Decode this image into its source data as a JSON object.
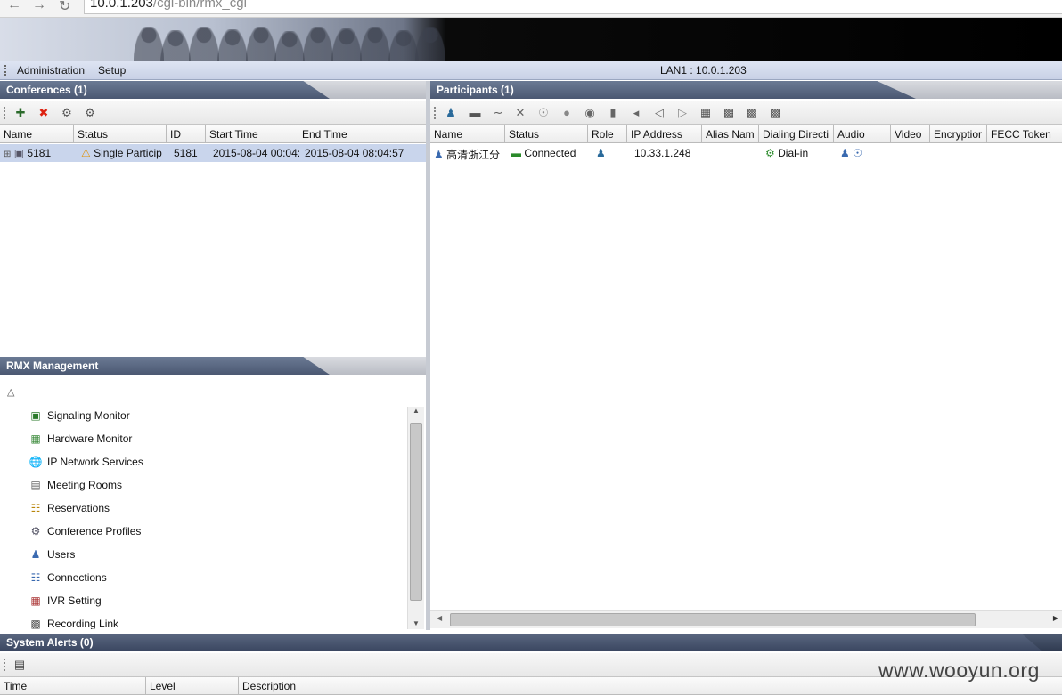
{
  "browser": {
    "url_host": "10.0.1.203",
    "url_path": "/cgi-bin/rmx_cgi"
  },
  "menu": {
    "items": [
      "Administration",
      "Setup"
    ],
    "network_label": "LAN1 : 10.0.1.203"
  },
  "conferences": {
    "title": "Conferences (1)",
    "columns": [
      "Name",
      "Status",
      "ID",
      "Start Time",
      "End Time"
    ],
    "rows": [
      {
        "name": "5181",
        "status": "Single Particip",
        "id": "5181",
        "start_time": "2015-08-04 00:04:",
        "end_time": "2015-08-04 08:04:57"
      }
    ]
  },
  "participants": {
    "title": "Participants (1)",
    "columns": [
      "Name",
      "Status",
      "Role",
      "IP Address",
      "Alias Nam",
      "Dialing Directi",
      "Audio",
      "Video",
      "Encryptior",
      "FECC Token"
    ],
    "rows": [
      {
        "name": "高清浙江分",
        "status": "Connected",
        "ip": "10.33.1.248",
        "dialing": "Dial-in"
      }
    ]
  },
  "rmx": {
    "title": "RMX Management",
    "items": [
      "Signaling Monitor",
      "Hardware Monitor",
      "IP Network Services",
      "Meeting Rooms",
      "Reservations",
      "Conference Profiles",
      "Users",
      "Connections",
      "IVR Setting",
      "Recording Link"
    ]
  },
  "alerts": {
    "title": "System Alerts (0)",
    "columns": [
      "Time",
      "Level",
      "Description"
    ]
  },
  "watermark": "www.wooyun.org"
}
